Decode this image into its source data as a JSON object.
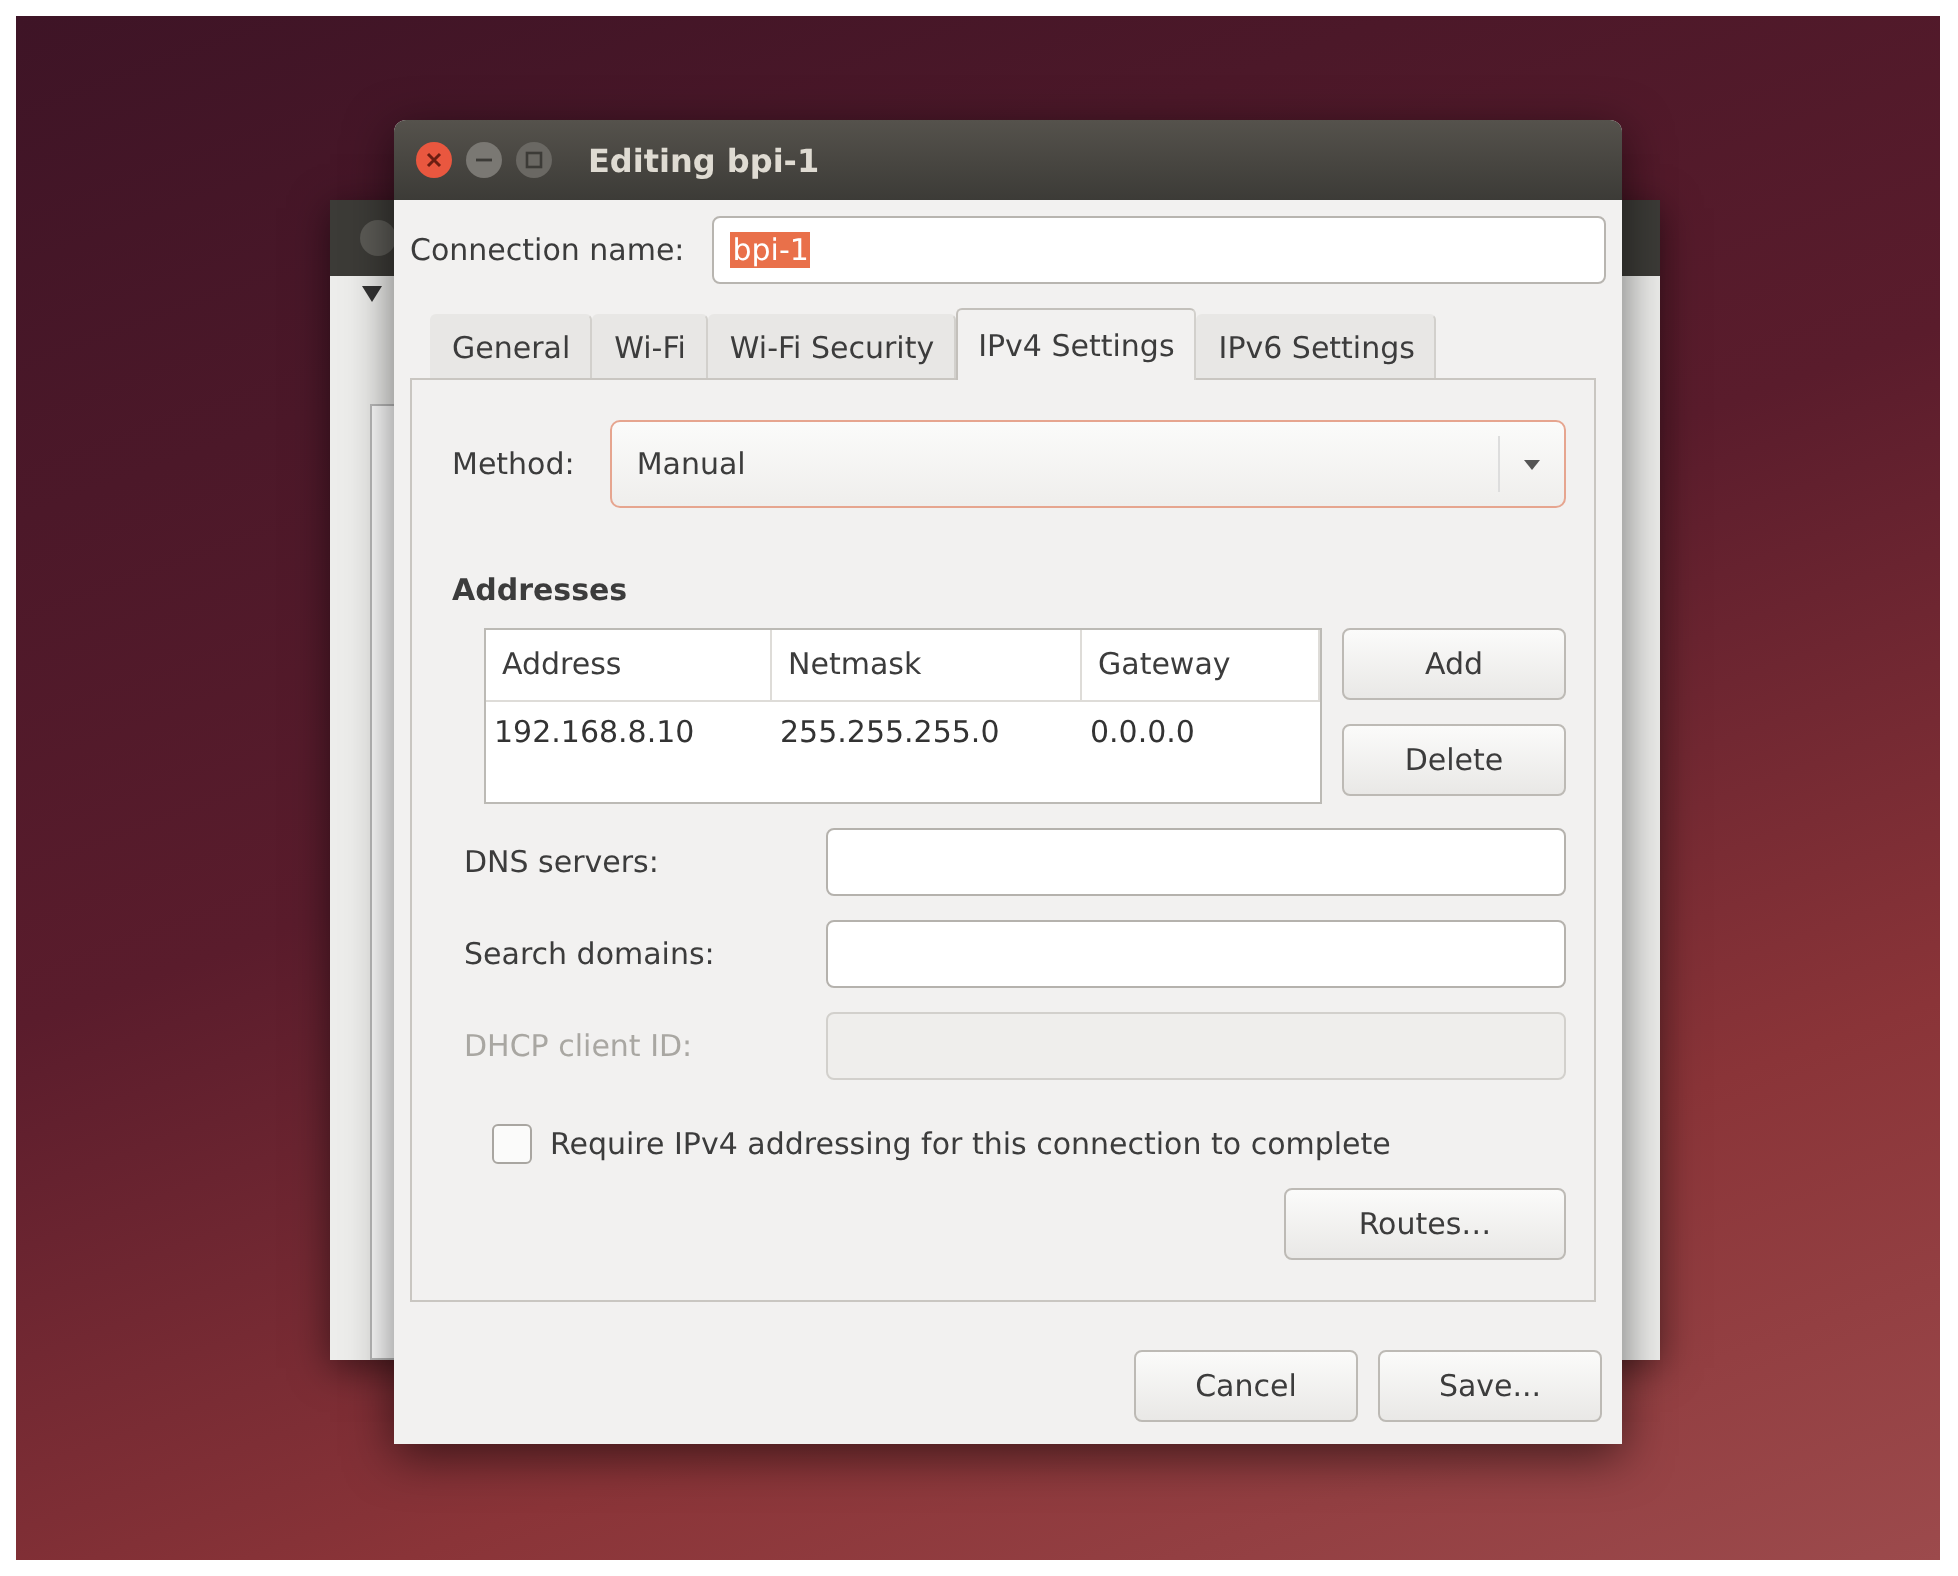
{
  "dialog": {
    "title": "Editing bpi-1",
    "connection_name": {
      "label": "Connection name:",
      "value": "bpi-1",
      "selected_text": true
    },
    "tabs": [
      {
        "label": "General",
        "selected": false
      },
      {
        "label": "Wi-Fi",
        "selected": false
      },
      {
        "label": "Wi-Fi Security",
        "selected": false
      },
      {
        "label": "IPv4 Settings",
        "selected": true
      },
      {
        "label": "IPv6 Settings",
        "selected": false
      }
    ],
    "method": {
      "label": "Method:",
      "value": "Manual"
    },
    "addresses": {
      "heading": "Addresses",
      "columns": [
        "Address",
        "Netmask",
        "Gateway"
      ],
      "rows": [
        [
          "192.168.8.10",
          "255.255.255.0",
          "0.0.0.0"
        ]
      ],
      "buttons": [
        "Add",
        "Delete"
      ]
    },
    "fields": [
      {
        "label": "DNS servers:",
        "disabled": false
      },
      {
        "label": "Search domains:",
        "disabled": false
      },
      {
        "label": "DHCP client ID:",
        "disabled": true
      }
    ],
    "require_checkbox": {
      "label": "Require IPv4 addressing for this connection to complete",
      "checked": false
    },
    "routes_button": "Routes…",
    "buttons": [
      "Cancel",
      "Save..."
    ]
  }
}
